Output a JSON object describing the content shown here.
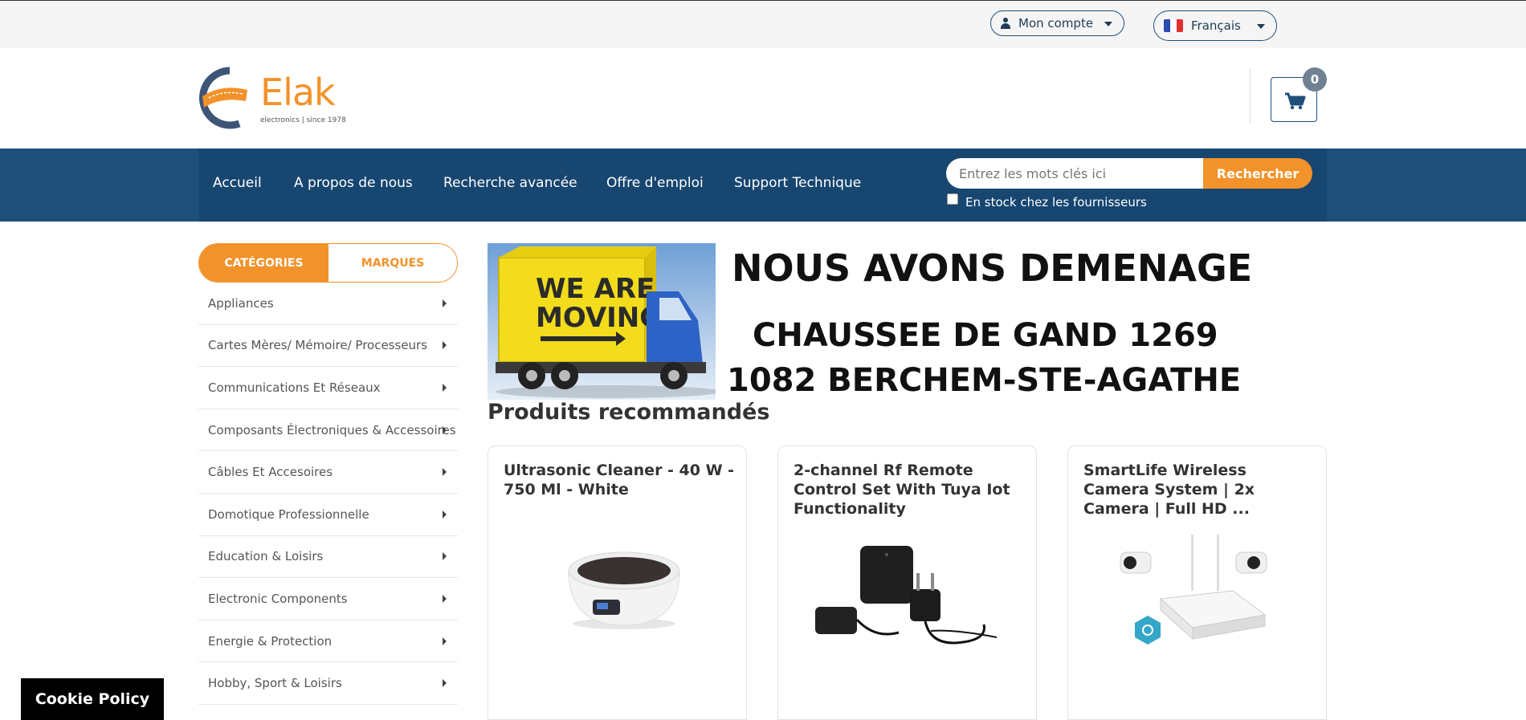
{
  "topbar": {
    "account_label": "Mon compte",
    "language_label": "Français"
  },
  "header": {
    "logo_name": "Elak",
    "logo_tagline": "electronics | since 1978",
    "cart_count": "0"
  },
  "nav": {
    "links": [
      "Accueil",
      "A propos de nous",
      "Recherche avancée",
      "Offre d'emploi",
      "Support Technique"
    ],
    "search_placeholder": "Entrez les mots clés ici",
    "search_button": "Rechercher",
    "stock_label": "En stock chez les fournisseurs"
  },
  "sidebar": {
    "tabs": [
      "CATÉGORIES",
      "MARQUES"
    ],
    "categories": [
      "Appliances",
      "Cartes Mères/ Mémoire/ Processeurs",
      "Communications Et Réseaux",
      "Composants Électroniques & Accessoires",
      "Câbles Et Accesoires",
      "Domotique Professionnelle",
      "Education & Loisirs",
      "Electronic Components",
      "Energie & Protection",
      "Hobby, Sport & Loisirs"
    ]
  },
  "banner": {
    "truck_text_1": "WE ARE",
    "truck_text_2": "MOVING",
    "headline": "NOUS AVONS DEMENAGE",
    "address_1": "CHAUSSEE DE GAND 1269",
    "address_2": "1082 BERCHEM-STE-AGATHE"
  },
  "recommended": {
    "title": "Produits recommandés",
    "products": [
      {
        "name": "Ultrasonic Cleaner - 40 W - 750 Ml - White"
      },
      {
        "name": "2-channel Rf Remote Control Set With Tuya Iot Functionality"
      },
      {
        "name": "SmartLife Wireless Camera System | 2x Camera | Full HD ..."
      }
    ]
  },
  "cookie": {
    "label": "Cookie Policy"
  },
  "colors": {
    "brand_orange": "#f2922a",
    "nav_blue": "#1f4f79"
  }
}
